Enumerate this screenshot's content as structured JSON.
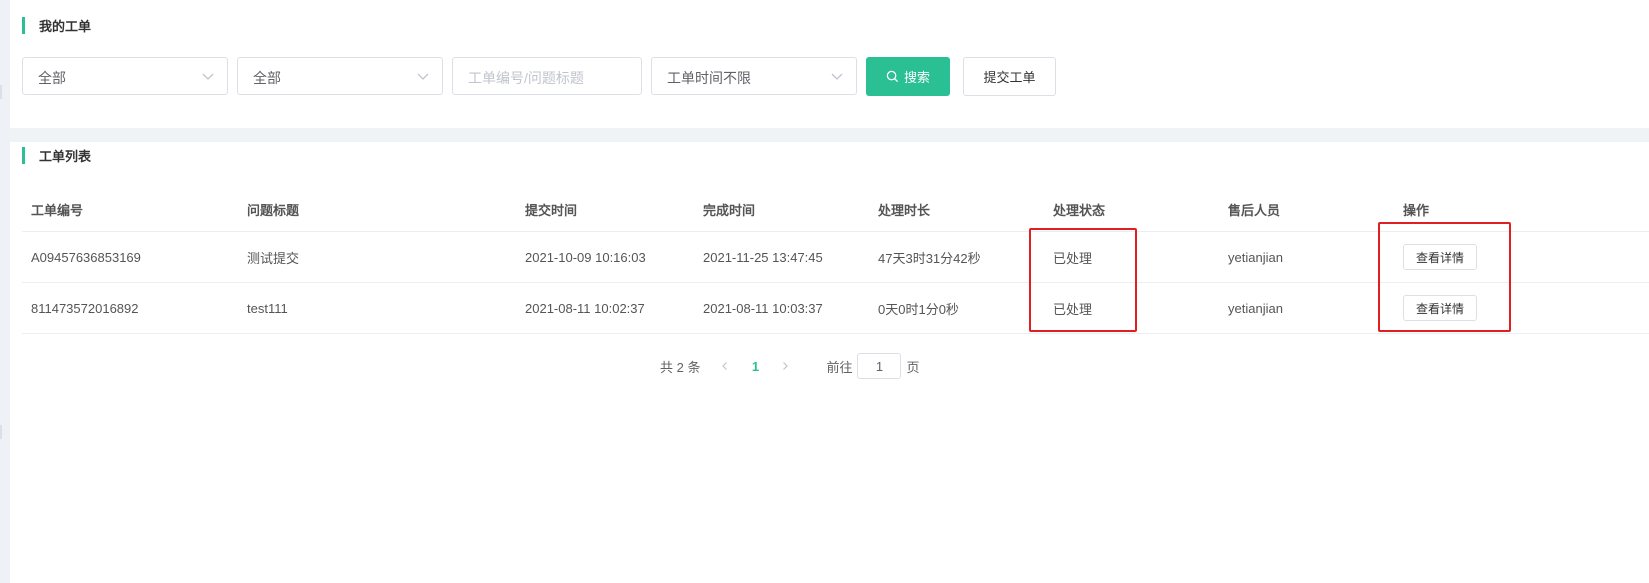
{
  "my_orders": {
    "title": "我的工单"
  },
  "filters": {
    "category_select": "全部",
    "status_select": "全部",
    "keyword_placeholder": "工单编号/问题标题",
    "time_select": "工单时间不限",
    "search_label": "搜索",
    "submit_label": "提交工单"
  },
  "order_list": {
    "title": "工单列表",
    "columns": [
      "工单编号",
      "问题标题",
      "提交时间",
      "完成时间",
      "处理时长",
      "处理状态",
      "售后人员",
      "操作"
    ],
    "rows": [
      {
        "id": "A09457636853169",
        "subject": "测试提交",
        "submitted": "2021-10-09 10:16:03",
        "completed": "2021-11-25 13:47:45",
        "duration": "47天3时31分42秒",
        "status": "已处理",
        "agent": "yetianjian",
        "action": "查看详情"
      },
      {
        "id": "811473572016892",
        "subject": "test111",
        "submitted": "2021-08-11 10:02:37",
        "completed": "2021-08-11 10:03:37",
        "duration": "0天0时1分0秒",
        "status": "已处理",
        "agent": "yetianjian",
        "action": "查看详情"
      }
    ]
  },
  "pagination": {
    "total_label": "共 2 条",
    "current_page": "1",
    "goto_label": "前往",
    "goto_value": "1",
    "page_unit": "页"
  },
  "colors": {
    "accent": "#2bbf94",
    "highlight": "#e02020"
  }
}
